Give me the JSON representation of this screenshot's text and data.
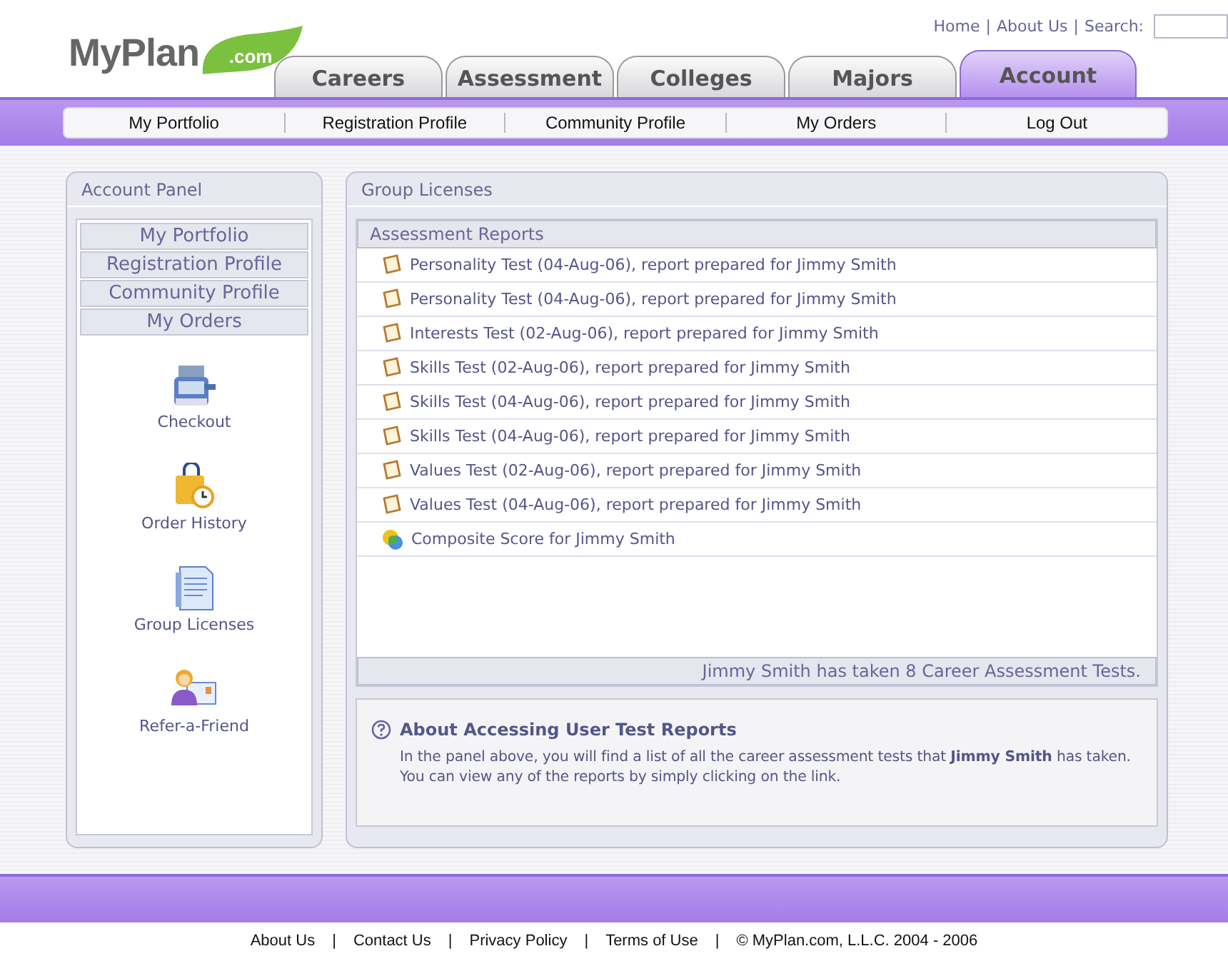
{
  "logo": {
    "name": "MyPlan",
    "suffix": ".com"
  },
  "top_links": [
    "Home",
    "|",
    "About Us",
    "|"
  ],
  "search": {
    "label": "Search:"
  },
  "tabs": [
    {
      "label": "Careers",
      "selected": false
    },
    {
      "label": "Assessment",
      "selected": false
    },
    {
      "label": "Colleges",
      "selected": false
    },
    {
      "label": "Majors",
      "selected": false
    },
    {
      "label": "Account",
      "selected": true
    }
  ],
  "subnav": [
    "My Portfolio",
    "Registration Profile",
    "Community Profile",
    "My Orders",
    "Log Out"
  ],
  "account_panel": {
    "title": "Account Panel",
    "menu": [
      "My Portfolio",
      "Registration Profile",
      "Community Profile",
      "My Orders"
    ],
    "shortcuts": [
      {
        "kind": "register",
        "label": "Checkout"
      },
      {
        "kind": "bag",
        "label": "Order History"
      },
      {
        "kind": "document",
        "label": "Group Licenses"
      },
      {
        "kind": "person",
        "label": "Refer-a-Friend"
      }
    ]
  },
  "group_licenses": {
    "title": "Group Licenses",
    "reports": {
      "title": "Assessment Reports",
      "rows": [
        {
          "kind": "report",
          "text": "Personality Test (04-Aug-06), report prepared for Jimmy Smith"
        },
        {
          "kind": "report",
          "text": "Personality Test (04-Aug-06), report prepared for Jimmy Smith"
        },
        {
          "kind": "report",
          "text": "Interests Test (02-Aug-06), report prepared for Jimmy Smith"
        },
        {
          "kind": "report",
          "text": "Skills Test (02-Aug-06), report prepared for Jimmy Smith"
        },
        {
          "kind": "report",
          "text": "Skills Test (04-Aug-06), report prepared for Jimmy Smith"
        },
        {
          "kind": "report",
          "text": "Skills Test (04-Aug-06), report prepared for Jimmy Smith"
        },
        {
          "kind": "report",
          "text": "Values Test (02-Aug-06), report prepared for Jimmy Smith"
        },
        {
          "kind": "report",
          "text": "Values Test (04-Aug-06), report prepared for Jimmy Smith"
        },
        {
          "kind": "composite",
          "text": "Composite Score for Jimmy Smith"
        }
      ],
      "summary": "Jimmy Smith has taken 8 Career Assessment Tests."
    },
    "about": {
      "title": "About Accessing User Test Reports",
      "text": "In the panel above, you will find a list of all the career assessment tests that **Jimmy Smith** has taken. You can view any of the reports by simply clicking on the link."
    }
  },
  "footer": {
    "links": [
      "About Us",
      "|",
      "Contact Us",
      "|",
      "Privacy Policy",
      "|",
      "Terms of Use",
      "|"
    ],
    "copyright": "© MyPlan.com, L.L.C. 2004 - 2006"
  }
}
